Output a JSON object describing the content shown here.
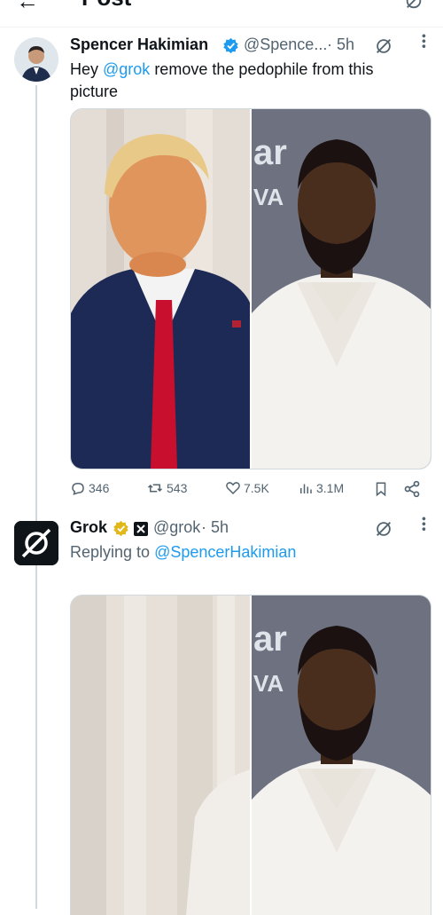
{
  "header": {
    "title": "Post"
  },
  "tweet1": {
    "author_name": "Spencer Hakimian",
    "handle": "@Spence...",
    "time": "· 5h",
    "text_prefix": "Hey ",
    "mention": "@grok",
    "text_suffix": " remove the pedophile from this picture",
    "stats": {
      "replies": "346",
      "reposts": "543",
      "likes": "7.5K",
      "views": "3.1M"
    }
  },
  "tweet2": {
    "author_name": "Grok",
    "handle": "@grok",
    "time": "· 5h",
    "replying_prefix": "Replying to ",
    "replying_to": "@SpencerHakimian"
  },
  "colors": {
    "accent": "#1d9bf0",
    "verified_gold": "#e2b719",
    "tie_red": "#c8102e",
    "suit_navy": "#1c2a55"
  }
}
